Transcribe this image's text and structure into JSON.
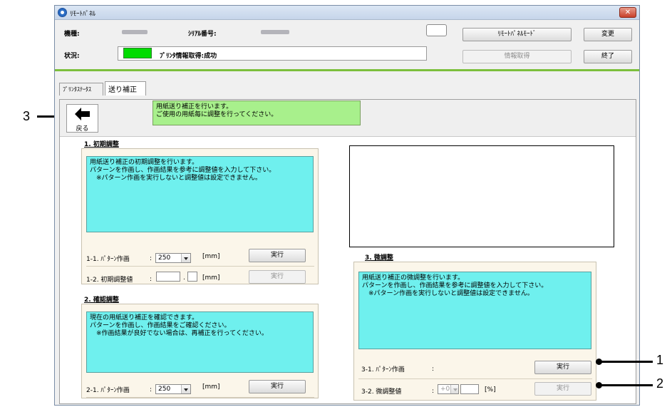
{
  "window": {
    "title": "ﾘﾓｰﾄﾊﾟﾈﾙ",
    "close": "✕"
  },
  "header": {
    "model_label": "機種:",
    "serial_label": "ｼﾘｱﾙ番号:",
    "status_label": "状況:",
    "status_text": "ﾌﾟﾘﾝﾀ情報取得:成功",
    "status_color": "#00dc00",
    "btn_remote_panel_mode": "ﾘﾓｰﾄﾊﾟﾈﾙﾓｰﾄﾞ",
    "btn_change": "変更",
    "btn_get_info": "情報取得",
    "btn_exit": "終了"
  },
  "tabs": [
    {
      "label": "ﾌﾟﾘﾝﾀｽﾃｰﾀｽ"
    },
    {
      "label": "送り補正"
    }
  ],
  "feed_correction": {
    "back_label": "戻る",
    "message_lines": [
      "用紙送り補正を行います。",
      "ご使用の用紙毎に調整を行ってください。"
    ],
    "initial": {
      "title": "1. 初期調整",
      "desc": [
        "用紙送り補正の初期調整を行います。",
        "パターンを作画し、作画結果を参考に調整値を入力して下さい。",
        "　※パターン作画を実行しないと調整値は設定できません。"
      ],
      "row1_label": "1-1. ﾊﾟﾀｰﾝ作画",
      "row1_colon": ":",
      "row1_value": "250",
      "row1_unit": "[mm]",
      "row1_button": "実行",
      "row2_label": "1-2. 初期調整値",
      "row2_colon": ":",
      "row2_dot": ".",
      "row2_unit": "[mm]",
      "row2_button": "実行"
    },
    "confirm": {
      "title": "2. 確認調整",
      "desc": [
        "現在の用紙送り補正を確認できます。",
        "パターンを作画し、作画結果をご確認ください。",
        "　※作画結果が良好でない場合は、再補正を行ってください。"
      ],
      "row1_label": "2-1. ﾊﾟﾀｰﾝ作画",
      "row1_colon": ":",
      "row1_value": "250",
      "row1_unit": "[mm]",
      "row1_button": "実行"
    },
    "fine": {
      "title": "3. 微調整",
      "desc": [
        "用紙送り補正の微調整を行います。",
        "パターンを作画し、作画結果を参考に調整値を入力して下さい。",
        "　※パターン作画を実行しないと調整値は設定できません。"
      ],
      "row1_label": "3-1. ﾊﾟﾀｰﾝ作画",
      "row1_colon": ":",
      "row1_button": "実行",
      "row2_label": "3-2. 微調整値",
      "row2_colon": ":",
      "row2_value": "+0.",
      "row2_unit": "[%]",
      "row2_button": "実行"
    }
  },
  "callouts": [
    "1",
    "2",
    "3"
  ]
}
